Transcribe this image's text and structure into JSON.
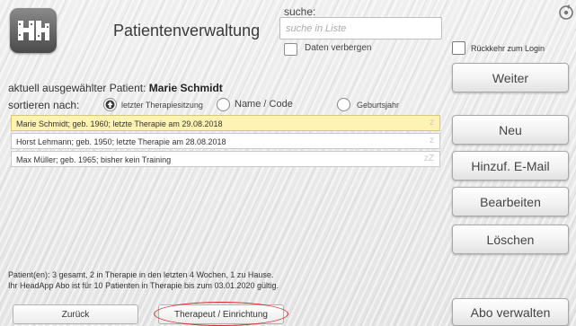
{
  "header": {
    "title": "Patientenverwaltung",
    "logo_icon": "headapp-logo-icon"
  },
  "search": {
    "label": "suche:",
    "placeholder": "suche in Liste",
    "hide_label": "Daten verbergen",
    "hide_checked": false
  },
  "return_login": {
    "label": "Rückkehr zum Login",
    "checked": false
  },
  "selected": {
    "prefix": "aktuell ausgewählter Patient:",
    "name": "Marie Schmidt"
  },
  "sort": {
    "label": "sortieren nach:",
    "options": [
      {
        "label": "letzter Therapiesitzung",
        "selected": true
      },
      {
        "label": "Name / Code",
        "selected": false
      },
      {
        "label": "Geburtsjahr",
        "selected": false
      }
    ]
  },
  "patients": [
    {
      "text": "Marie Schmidt; geb. 1960; letzte Therapie am 29.08.2018",
      "active": true,
      "marker": "z"
    },
    {
      "text": "Horst Lehmann; geb. 1950; letzte Therapie am 28.08.2018",
      "active": false,
      "marker": "z"
    },
    {
      "text": "Max Müller; geb. 1965; bisher kein Training",
      "active": false,
      "marker": "zZ"
    }
  ],
  "buttons": {
    "weiter": "Weiter",
    "neu": "Neu",
    "email": "Hinzuf. E-Mail",
    "bearbeiten": "Bearbeiten",
    "loeschen": "Löschen",
    "abo": "Abo verwalten",
    "zurueck": "Zurück",
    "therapeut": "Therapeut / Einrichtung"
  },
  "footer": {
    "line1": "Patient(en): 3 gesamt, 2 in Therapie in den letzten 4 Wochen, 1 zu Hause.",
    "line2": "Ihr HeadApp Abo ist für 10 Patienten in Therapie bis zum 03.01.2020 gültig."
  },
  "colors": {
    "active_row": "#fff3b3",
    "highlight_ring": "#d52a2a"
  }
}
